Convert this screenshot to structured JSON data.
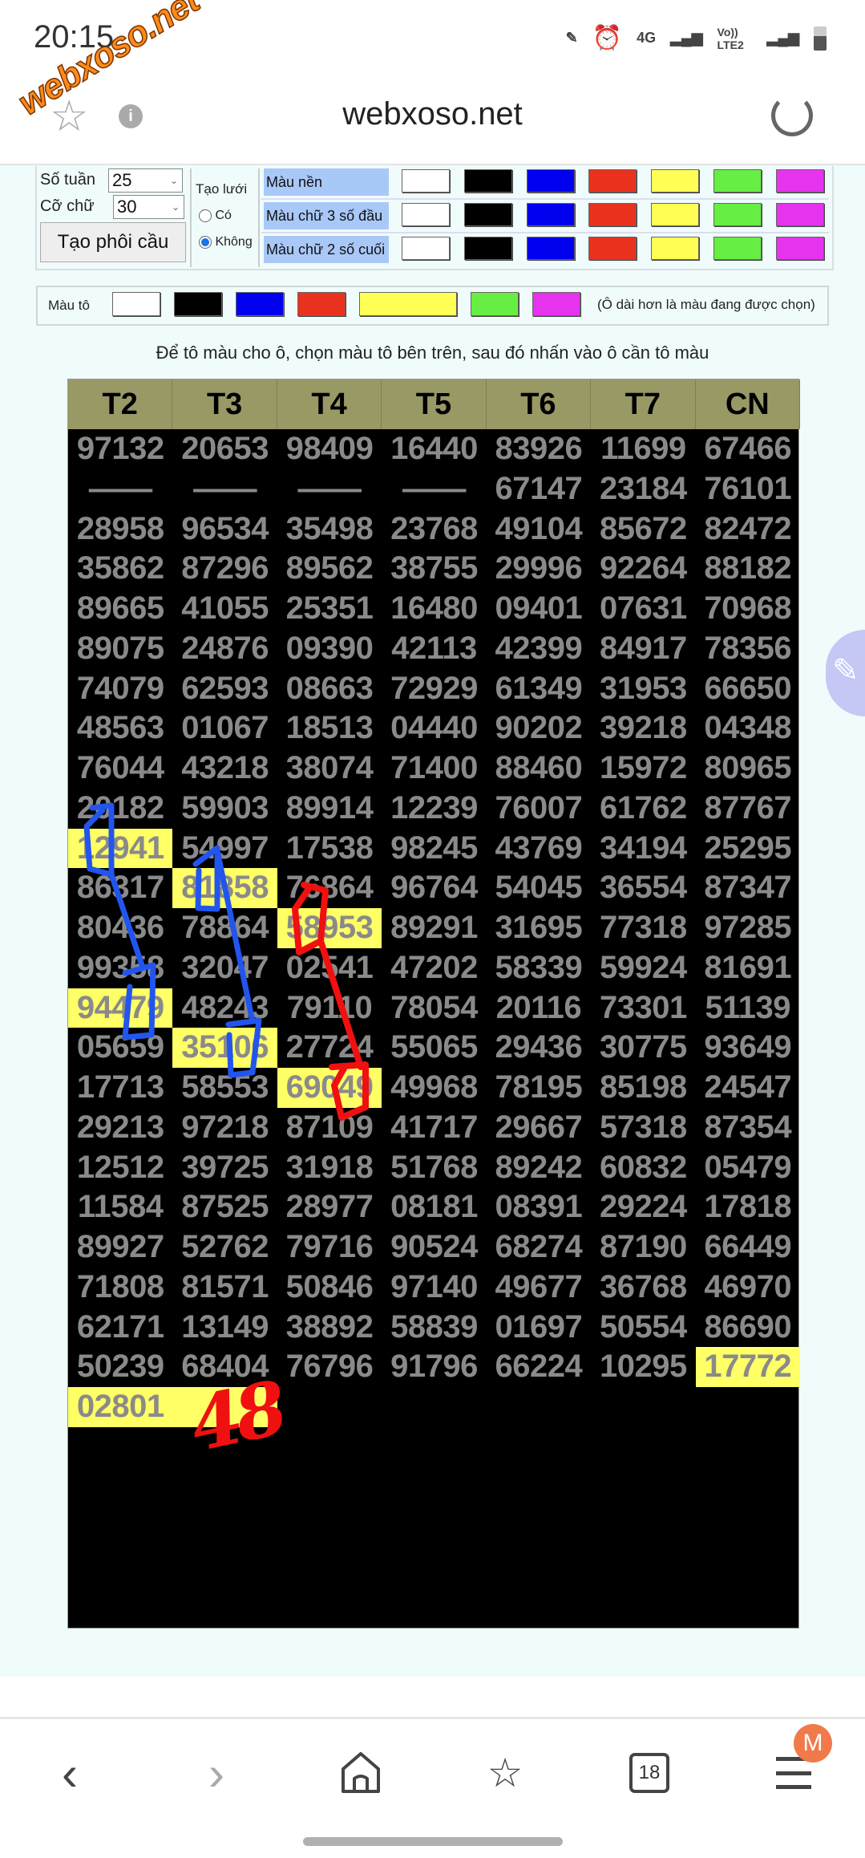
{
  "status_bar": {
    "time": "20:15",
    "network": "4G",
    "volte": "Vo)) LTE2"
  },
  "watermark": "webxoso.net",
  "url_bar": {
    "title": "webxoso.net"
  },
  "controls": {
    "weeks_label": "Số tuần",
    "weeks_value": "25",
    "font_label": "Cỡ chữ",
    "font_value": "30",
    "generate_button": "Tạo phôi cầu",
    "grid_label": "Tạo lưới",
    "grid_options": [
      {
        "label": "Có",
        "selected": false
      },
      {
        "label": "Không",
        "selected": true
      }
    ],
    "color_rows": [
      "Màu nền",
      "Màu chữ 3 số đầu",
      "Màu chữ 2 số cuối"
    ],
    "swatches": [
      "#ffffff",
      "#000000",
      "#0000ee",
      "#e8321e",
      "#ffff55",
      "#66ee44",
      "#e633ee"
    ]
  },
  "paint": {
    "label": "Màu tô",
    "selected": "#ffff55",
    "note": "(Ô dài hơn là màu đang được chọn)"
  },
  "instruction": "Để tô màu cho ô, chọn màu tô bên trên, sau đó nhấn vào ô cần tô màu",
  "table": {
    "headers": [
      "T2",
      "T3",
      "T4",
      "T5",
      "T6",
      "T7",
      "CN"
    ],
    "highlight_color": "#ffff66",
    "rows": [
      [
        "97132",
        "20653",
        "98409",
        "16440",
        "83926",
        "11699",
        "67466"
      ],
      [
        "——",
        "——",
        "——",
        "——",
        "67147",
        "23184",
        "76101"
      ],
      [
        "28958",
        "96534",
        "35498",
        "23768",
        "49104",
        "85672",
        "82472"
      ],
      [
        "35862",
        "87296",
        "89562",
        "38755",
        "29996",
        "92264",
        "88182"
      ],
      [
        "89665",
        "41055",
        "25351",
        "16480",
        "09401",
        "07631",
        "70968"
      ],
      [
        "89075",
        "24876",
        "09390",
        "42113",
        "42399",
        "84917",
        "78356"
      ],
      [
        "74079",
        "62593",
        "08663",
        "72929",
        "61349",
        "31953",
        "66650"
      ],
      [
        "48563",
        "01067",
        "18513",
        "04440",
        "90202",
        "39218",
        "04348"
      ],
      [
        "76044",
        "43218",
        "38074",
        "71400",
        "88460",
        "15972",
        "80965"
      ],
      [
        "20182",
        "59903",
        "89914",
        "12239",
        "76007",
        "61762",
        "87767"
      ],
      [
        "12941",
        "54997",
        "17538",
        "98245",
        "43769",
        "34194",
        "25295"
      ],
      [
        "86317",
        "81858",
        "76864",
        "96764",
        "54045",
        "36554",
        "87347"
      ],
      [
        "80436",
        "78864",
        "58953",
        "89291",
        "31695",
        "77318",
        "97285"
      ],
      [
        "99358",
        "32047",
        "02541",
        "47202",
        "58339",
        "59924",
        "81691"
      ],
      [
        "94479",
        "48243",
        "79110",
        "78054",
        "20116",
        "73301",
        "51139"
      ],
      [
        "05659",
        "35106",
        "27724",
        "55065",
        "29436",
        "30775",
        "93649"
      ],
      [
        "17713",
        "58553",
        "69049",
        "49968",
        "78195",
        "85198",
        "24547"
      ],
      [
        "29213",
        "97218",
        "87109",
        "41717",
        "29667",
        "57318",
        "87354"
      ],
      [
        "12512",
        "39725",
        "31918",
        "51768",
        "89242",
        "60832",
        "05479"
      ],
      [
        "11584",
        "87525",
        "28977",
        "08181",
        "08391",
        "29224",
        "17818"
      ],
      [
        "89927",
        "52762",
        "79716",
        "90524",
        "68274",
        "87190",
        "66449"
      ],
      [
        "71808",
        "81571",
        "50846",
        "97140",
        "49677",
        "36768",
        "46970"
      ],
      [
        "62171",
        "13149",
        "38892",
        "58839",
        "01697",
        "50554",
        "86690"
      ],
      [
        "50239",
        "68404",
        "76796",
        "91796",
        "66224",
        "10295",
        "17772"
      ],
      [
        "02801",
        "",
        "",
        "",
        "",
        "",
        ""
      ]
    ],
    "highlighted": [
      [
        10,
        0
      ],
      [
        11,
        1
      ],
      [
        12,
        2
      ],
      [
        14,
        0
      ],
      [
        15,
        1
      ],
      [
        16,
        2
      ],
      [
        23,
        6
      ],
      [
        24,
        0
      ],
      [
        24,
        1
      ]
    ]
  },
  "annotations": {
    "handwritten_text": "48",
    "colors": [
      "#2255ee",
      "#f01010"
    ]
  },
  "nav": {
    "tab_count": "18",
    "profile_initial": "M",
    "badge_color": "#f07a4a"
  }
}
